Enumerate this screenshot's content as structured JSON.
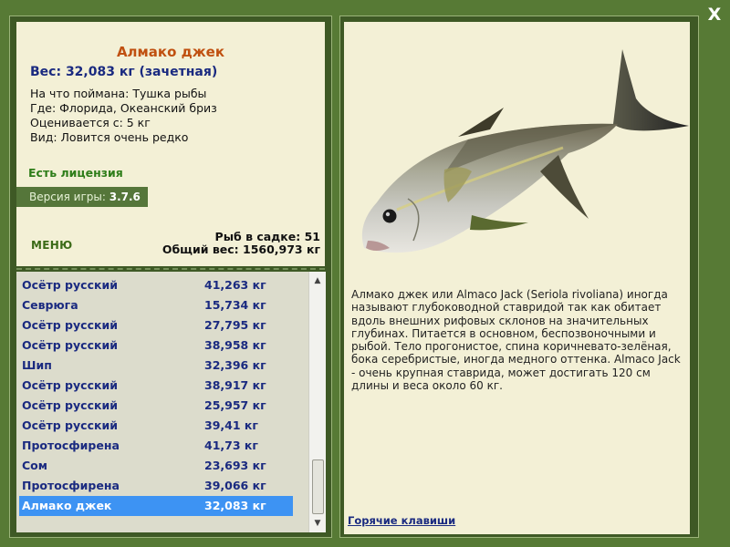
{
  "window": {
    "close_label": "X"
  },
  "fish": {
    "name": "Алмако джек",
    "weight_line": "Вес: 32,083 кг (зачетная)",
    "bait_line": "На что поймана: Тушка рыбы",
    "place_line": "Где: Флорида, Океанский бриз",
    "rated_line": "Оценивается с: 5 кг",
    "kind_line": "Вид: Ловится очень редко",
    "license": "Есть лицензия",
    "description": "Алмако джек или Almaco Jack (Seriola rivoliana) иногда называют глубоководной ставридой так как обитает вдоль внешних рифовых склонов на значительных глубинах. Питается в основном, беспозвоночными и рыбой. Тело прогонистое, спина коричневато-зелёная, бока серебристые, иногда медного оттенка. Almaco Jack - очень крупная ставрида, может достигать 120 см длины и веса около 60 кг."
  },
  "version": {
    "label": "Версия игры:",
    "value": "3.7.6"
  },
  "menu_label": "МЕНЮ",
  "stats": {
    "count_line": "Рыб в садке: 51",
    "total_line": "Общий вес: 1560,973 кг"
  },
  "catch_list": [
    {
      "name": "Осётр русский",
      "weight": "41,263 кг"
    },
    {
      "name": "Севрюга",
      "weight": "15,734 кг"
    },
    {
      "name": "Осётр русский",
      "weight": "27,795 кг"
    },
    {
      "name": "Осётр русский",
      "weight": "38,958 кг"
    },
    {
      "name": "Шип",
      "weight": "32,396 кг"
    },
    {
      "name": "Осётр русский",
      "weight": "38,917 кг"
    },
    {
      "name": "Осётр русский",
      "weight": "25,957 кг"
    },
    {
      "name": "Осётр русский",
      "weight": "39,41 кг"
    },
    {
      "name": "Протосфирена",
      "weight": "41,73 кг"
    },
    {
      "name": "Сом",
      "weight": "23,693 кг"
    },
    {
      "name": "Протосфирена",
      "weight": "39,066 кг"
    },
    {
      "name": "Алмако джек",
      "weight": "32,083 кг"
    }
  ],
  "selected_index": 11,
  "hotkeys_label": "Горячие клавиши",
  "colors": {
    "background": "#577a35",
    "panel": "#f3f0d6",
    "title": "#c05010",
    "list_text": "#1a2a80",
    "selection": "#3d93f3",
    "license": "#2e7d19"
  }
}
